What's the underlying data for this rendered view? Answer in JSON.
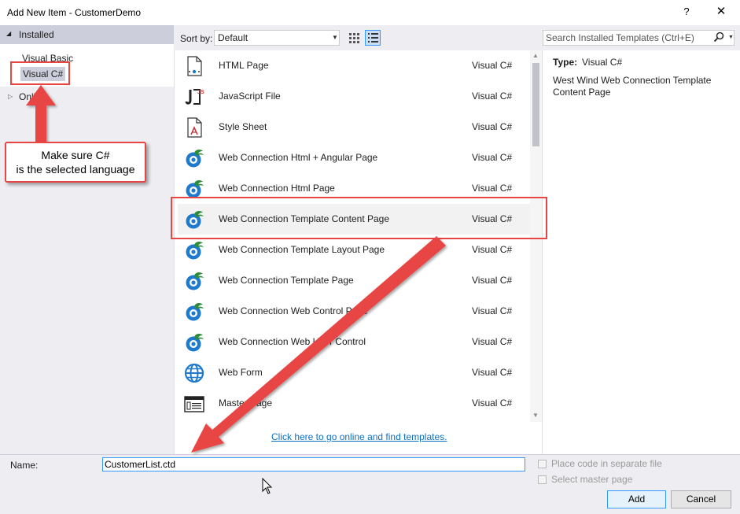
{
  "window": {
    "title": "Add New Item - CustomerDemo",
    "help_label": "?",
    "close_label": "✕"
  },
  "tree": {
    "installed_label": "Installed",
    "items": [
      "Visual Basic",
      "Visual C#"
    ],
    "selected": "Visual C#",
    "online_label": "Online"
  },
  "callout": {
    "line1": "Make sure C#",
    "line2": "is the selected language"
  },
  "toolbar": {
    "sort_label": "Sort by:",
    "sort_value": "Default"
  },
  "search": {
    "placeholder": "Search Installed Templates (Ctrl+E)"
  },
  "templates": [
    {
      "name": "HTML Page",
      "lang": "Visual C#",
      "icon": "html-page-icon"
    },
    {
      "name": "JavaScript File",
      "lang": "Visual C#",
      "icon": "javascript-file-icon"
    },
    {
      "name": "Style Sheet",
      "lang": "Visual C#",
      "icon": "style-sheet-icon"
    },
    {
      "name": "Web Connection Html + Angular Page",
      "lang": "Visual C#",
      "icon": "web-connection-icon"
    },
    {
      "name": "Web Connection Html Page",
      "lang": "Visual C#",
      "icon": "web-connection-icon"
    },
    {
      "name": "Web Connection Template Content Page",
      "lang": "Visual C#",
      "icon": "web-connection-icon"
    },
    {
      "name": "Web Connection Template Layout Page",
      "lang": "Visual C#",
      "icon": "web-connection-icon"
    },
    {
      "name": "Web Connection Template Page",
      "lang": "Visual C#",
      "icon": "web-connection-icon"
    },
    {
      "name": "Web Connection Web Control Page",
      "lang": "Visual C#",
      "icon": "web-connection-icon"
    },
    {
      "name": "Web Connection Web User Control",
      "lang": "Visual C#",
      "icon": "web-connection-icon"
    },
    {
      "name": "Web Form",
      "lang": "Visual C#",
      "icon": "web-form-globe-icon"
    },
    {
      "name": "Master Page",
      "lang": "Visual C#",
      "icon": "master-page-icon"
    }
  ],
  "selected_template": "Web Connection Template Content Page",
  "online_link": "Click here to go online and find templates.",
  "info": {
    "type_label": "Type:",
    "type_value": "Visual C#",
    "description": "West Wind Web Connection Template Content Page"
  },
  "form": {
    "name_label": "Name:",
    "name_value": "CustomerList.ctd",
    "place_code_label": "Place code in separate file",
    "master_page_label": "Select master page",
    "add_label": "Add",
    "cancel_label": "Cancel"
  },
  "colors": {
    "annotation_red": "#e84545",
    "accent_blue": "#3399ff",
    "link_blue": "#0e70c0"
  }
}
